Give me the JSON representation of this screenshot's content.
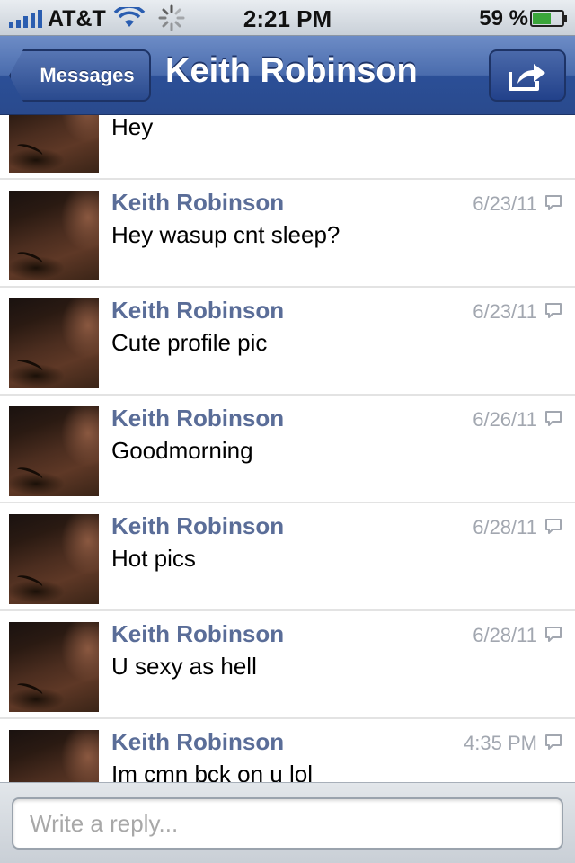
{
  "status_bar": {
    "carrier": "AT&T",
    "time": "2:21 PM",
    "battery_percent": "59 %"
  },
  "nav_bar": {
    "back_label": "Messages",
    "title": "Keith Robinson",
    "share_icon": "share-icon"
  },
  "messages": [
    {
      "sender": "",
      "body": "Hey",
      "date": ""
    },
    {
      "sender": "Keith Robinson",
      "body": "Hey wasup cnt sleep?",
      "date": "6/23/11"
    },
    {
      "sender": "Keith Robinson",
      "body": "Cute profile pic",
      "date": "6/23/11"
    },
    {
      "sender": "Keith Robinson",
      "body": "Goodmorning",
      "date": "6/26/11"
    },
    {
      "sender": "Keith Robinson",
      "body": "Hot pics",
      "date": "6/28/11"
    },
    {
      "sender": "Keith Robinson",
      "body": "U sexy as hell",
      "date": "6/28/11"
    },
    {
      "sender": "Keith Robinson",
      "body": "Im cmn bck on u lol",
      "date": "4:35 PM"
    }
  ],
  "reply": {
    "placeholder": "Write a reply..."
  },
  "colors": {
    "nav_blue": "#2b4f97",
    "sender_name": "#5a6d98",
    "timestamp": "#a2a7b0"
  }
}
